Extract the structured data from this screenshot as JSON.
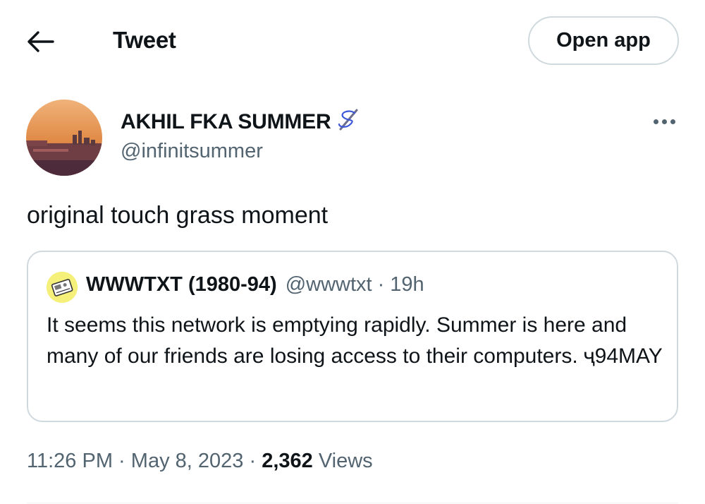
{
  "header": {
    "back_icon": "arrow-left-icon",
    "title": "Tweet",
    "open_app_label": "Open app"
  },
  "tweet": {
    "author_name": "AKHIL FKA SUMMER",
    "author_emoji_icon": "needle-and-thread-emoji",
    "author_handle": "@infinitsummer",
    "more_icon": "more-horizontal-icon",
    "text": "original touch grass moment",
    "timestamp": "11:26 PM",
    "date": "May 8, 2023",
    "separator": "·",
    "views_count": "2,362",
    "views_label": "Views"
  },
  "quote": {
    "author_name": "WWWTXT (1980-94)",
    "author_handle": "@wwwtxt",
    "separator": "·",
    "time": "19h",
    "text": "It seems this network is emptying rapidly. Summer is here and many of our friends are losing access to their computers. ҷ94MAY"
  },
  "colors": {
    "text_primary": "#0f1419",
    "text_secondary": "#536471",
    "border": "#cfd9de",
    "background": "#ffffff"
  }
}
